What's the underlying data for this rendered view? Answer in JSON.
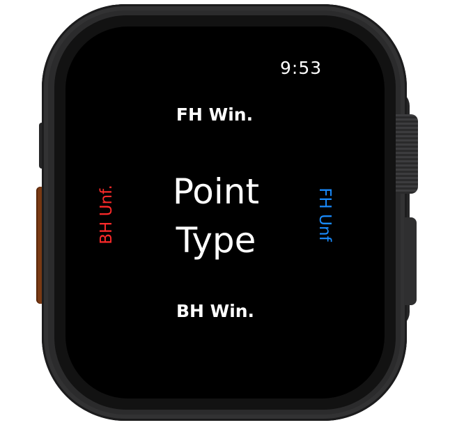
{
  "status_bar": {
    "time": "9:53"
  },
  "screen": {
    "title_line1": "Point",
    "title_line2": "Type",
    "options": {
      "top": "FH Win.",
      "bottom": "BH Win.",
      "left": "BH Unf.",
      "right": "FH Unf"
    }
  },
  "colors": {
    "screen_background": "#000000",
    "text": "#ffffff",
    "left_option": "#ff2a2a",
    "right_option": "#1a8cff",
    "action_button": "#7a3a14",
    "case": "#2b2b2c"
  },
  "icons": {
    "digital_crown": "digital-crown-icon",
    "side_button": "side-button-icon",
    "action_button": "action-button-icon"
  }
}
